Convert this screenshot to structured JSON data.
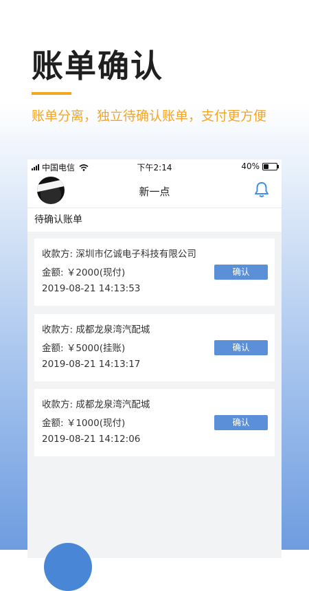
{
  "hero": {
    "title": "账单确认",
    "subtitle": "账单分离，独立待确认账单，支付更方便"
  },
  "status_bar": {
    "carrier": "中国电信",
    "time": "下午2:14",
    "battery": "40%",
    "battery_level": 0.4
  },
  "navbar": {
    "title": "新一点"
  },
  "section": {
    "title": "待确认账单"
  },
  "bills": [
    {
      "payee": "收款方: 深圳市亿诚电子科技有限公司",
      "amount": "金额: ￥2000(现付)",
      "time": "2019-08-21 14:13:53",
      "button": "确认"
    },
    {
      "payee": "收款方: 成都龙泉湾汽配城",
      "amount": "金额: ￥5000(挂账)",
      "time": "2019-08-21 14:13:17",
      "button": "确认"
    },
    {
      "payee": "收款方: 成都龙泉湾汽配城",
      "amount": "金额: ￥1000(现付)",
      "time": "2019-08-21 14:12:06",
      "button": "确认"
    }
  ],
  "colors": {
    "accent_orange": "#f5a623",
    "button_blue": "#5b90d9",
    "bell_blue": "#3d8ef0"
  }
}
